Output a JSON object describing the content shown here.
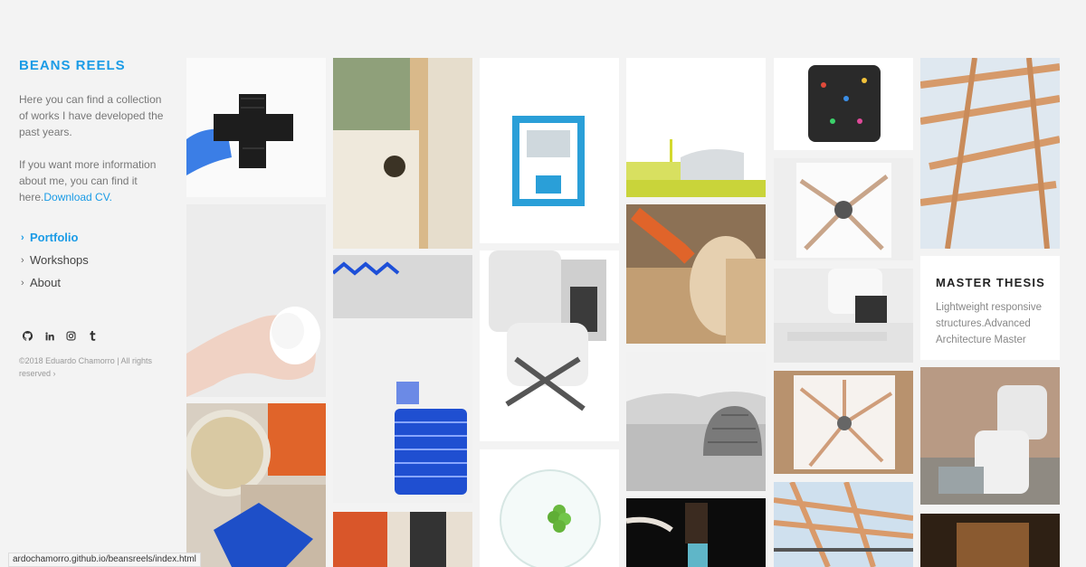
{
  "site": {
    "title": "BEANS REELS",
    "intro_1": "Here you can find a collection of works I have developed the past years.",
    "intro_2_prefix": "If you want more information about me, you can find it here.",
    "cv_link": "Download CV."
  },
  "nav": {
    "portfolio": "Portfolio",
    "workshops": "Workshops",
    "about": "About"
  },
  "social": {
    "icons": [
      "github-icon",
      "linkedin-icon",
      "instagram-icon",
      "tumblr-icon"
    ]
  },
  "footer": {
    "copyright": "©2018 Eduardo Chamorro | All rights reserved"
  },
  "featured": {
    "title": "MASTER THESIS",
    "description": "Lightweight responsive structures.Advanced Architecture Master"
  },
  "status_bar": {
    "url": "ardochamorro.github.io/beansreels/index.html"
  },
  "colors": {
    "accent": "#1a9be6",
    "background": "#f3f3f3"
  }
}
